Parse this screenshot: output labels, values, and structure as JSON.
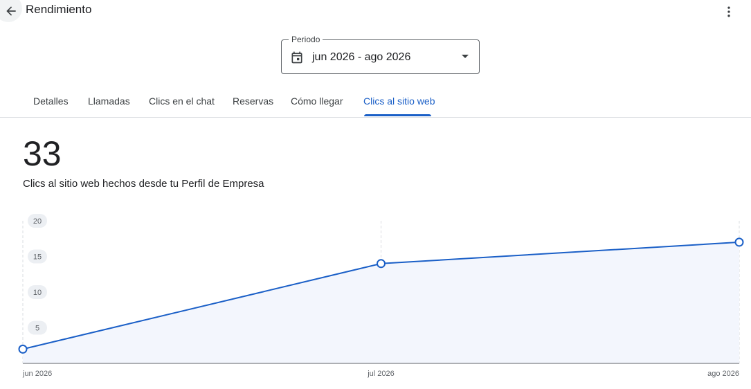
{
  "header": {
    "title": "Rendimiento",
    "back_icon": "arrow-back-icon",
    "menu_icon": "more-vert-icon"
  },
  "period": {
    "label": "Periodo",
    "value": "jun 2026 - ago 2026",
    "icon": "calendar-icon",
    "caret_icon": "arrow-drop-down-icon"
  },
  "tabs": [
    {
      "label": "Detalles"
    },
    {
      "label": "Llamadas"
    },
    {
      "label": "Clics en el chat"
    },
    {
      "label": "Reservas"
    },
    {
      "label": "Cómo llegar"
    },
    {
      "label": "Clics al sitio web",
      "active": true
    }
  ],
  "summary": {
    "total": "33",
    "description": "Clics al sitio web hechos desde tu Perfil de Empresa"
  },
  "colors": {
    "accent": "#1a5fc7",
    "area_fill": "#f3f6fd"
  },
  "chart_data": {
    "type": "area",
    "x": [
      "jun 2026",
      "jul 2026",
      "ago 2026"
    ],
    "series": [
      {
        "values": [
          2,
          14,
          17
        ]
      }
    ],
    "yticks": [
      "5",
      "10",
      "15",
      "20"
    ],
    "ylim": [
      0,
      20
    ],
    "grid": "vertical dashed",
    "title": "",
    "xlabel": "",
    "ylabel": ""
  }
}
